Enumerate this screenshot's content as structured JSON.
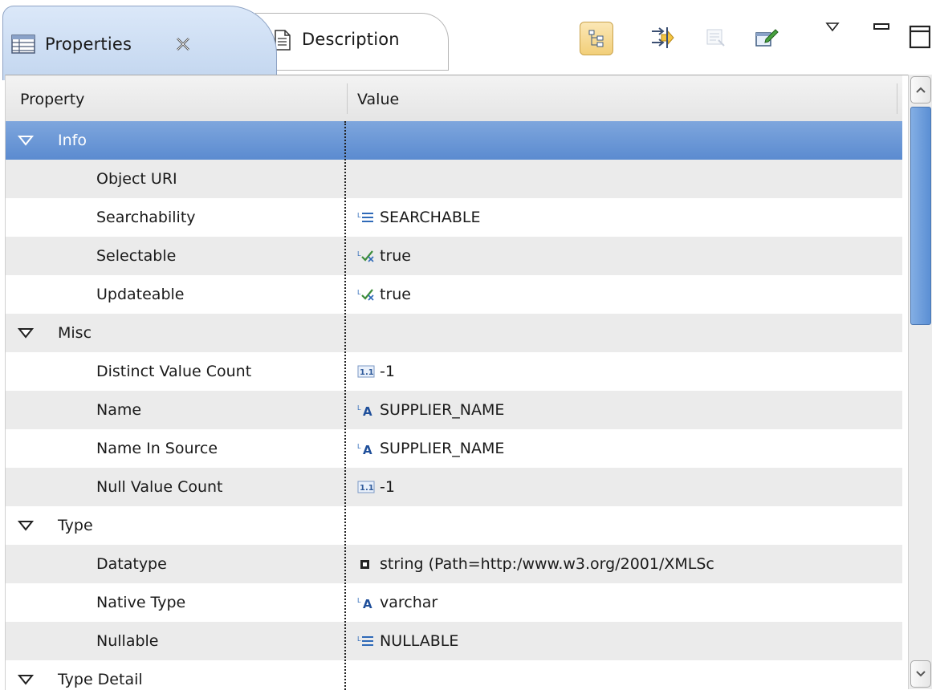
{
  "tabs": {
    "properties_label": "Properties",
    "description_label": "Description"
  },
  "toolbar": {
    "icons": [
      "tree-layout-icon",
      "arrange-icon",
      "restore-defaults-icon",
      "edit-icon",
      "view-menu-icon",
      "minimize-icon",
      "maximize-icon"
    ]
  },
  "table": {
    "col_property": "Property",
    "col_value": "Value",
    "rows": [
      {
        "type": "category",
        "label": "Info",
        "selected": true
      },
      {
        "type": "leaf",
        "label": "Object URI",
        "value": "",
        "icon": ""
      },
      {
        "type": "leaf",
        "label": "Searchability",
        "value": "SEARCHABLE",
        "icon": "enum-icon"
      },
      {
        "type": "leaf",
        "label": "Selectable",
        "value": "true",
        "icon": "boolean-icon"
      },
      {
        "type": "leaf",
        "label": "Updateable",
        "value": "true",
        "icon": "boolean-icon"
      },
      {
        "type": "category",
        "label": "Misc"
      },
      {
        "type": "leaf",
        "label": "Distinct Value Count",
        "value": "-1",
        "icon": "number-icon"
      },
      {
        "type": "leaf",
        "label": "Name",
        "value": "SUPPLIER_NAME",
        "icon": "string-icon"
      },
      {
        "type": "leaf",
        "label": "Name In Source",
        "value": "SUPPLIER_NAME",
        "icon": "string-icon"
      },
      {
        "type": "leaf",
        "label": "Null Value Count",
        "value": "-1",
        "icon": "number-icon"
      },
      {
        "type": "category",
        "label": "Type"
      },
      {
        "type": "leaf",
        "label": "Datatype",
        "value": "string (Path=http:/www.w3.org/2001/XMLSc",
        "icon": "datatype-icon"
      },
      {
        "type": "leaf",
        "label": "Native Type",
        "value": "varchar",
        "icon": "string-icon"
      },
      {
        "type": "leaf",
        "label": "Nullable",
        "value": "NULLABLE",
        "icon": "enum-icon"
      },
      {
        "type": "category",
        "label": "Type Detail"
      }
    ]
  },
  "colors": {
    "selection": "#5b8bd0",
    "row_alt": "#ebebeb",
    "tab_active": "#c3d6ef"
  }
}
